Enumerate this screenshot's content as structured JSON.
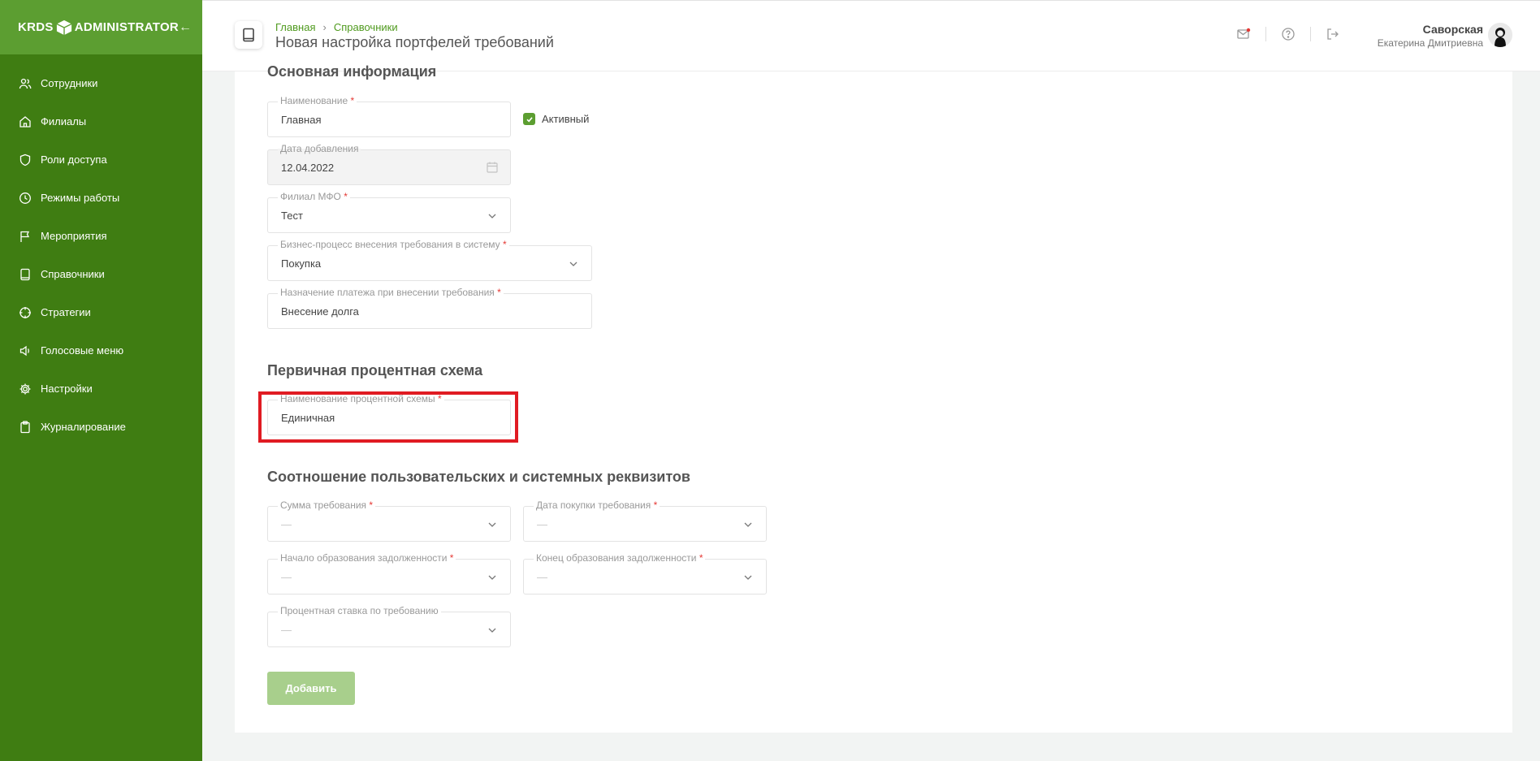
{
  "brand": {
    "logo_left": "KRDS",
    "logo_right": "ADMINISTRATOR"
  },
  "sidebar": {
    "items": [
      {
        "label": "Сотрудники",
        "icon": "users-icon"
      },
      {
        "label": "Филиалы",
        "icon": "home-icon"
      },
      {
        "label": "Роли доступа",
        "icon": "shield-icon"
      },
      {
        "label": "Режимы работы",
        "icon": "clock-icon"
      },
      {
        "label": "Мероприятия",
        "icon": "flag-icon"
      },
      {
        "label": "Справочники",
        "icon": "book-icon"
      },
      {
        "label": "Стратегии",
        "icon": "crosshair-icon"
      },
      {
        "label": "Голосовые меню",
        "icon": "speaker-icon"
      },
      {
        "label": "Настройки",
        "icon": "gear-icon"
      },
      {
        "label": "Журналирование",
        "icon": "clipboard-icon"
      }
    ]
  },
  "header": {
    "breadcrumb": [
      "Главная",
      "Справочники"
    ],
    "title": "Новая настройка портфелей требований",
    "user": {
      "last_name": "Саворская",
      "first_name": "Екатерина Дмитриевна"
    }
  },
  "form": {
    "section_main": "Основная информация",
    "name": {
      "label": "Наименование",
      "value": "Главная"
    },
    "active": {
      "label": "Активный",
      "checked": true
    },
    "date_added": {
      "label": "Дата добавления",
      "value": "12.04.2022"
    },
    "branch": {
      "label": "Филиал МФО",
      "value": "Тест"
    },
    "business_process": {
      "label": "Бизнес-процесс внесения требования в систему",
      "value": "Покупка"
    },
    "payment_purpose": {
      "label": "Назначение платежа при внесении требования",
      "value": "Внесение долга"
    },
    "section_interest": "Первичная процентная схема",
    "scheme_name": {
      "label": "Наименование процентной схемы",
      "value": "Единичная"
    },
    "section_mapping": "Соотношение пользовательских и системных реквизитов",
    "claim_amount": {
      "label": "Сумма требования",
      "value": "—"
    },
    "purchase_date": {
      "label": "Дата покупки требования",
      "value": "—"
    },
    "debt_start": {
      "label": "Начало образования задолженности",
      "value": "—"
    },
    "debt_end": {
      "label": "Конец образования задолженности",
      "value": "—"
    },
    "interest_rate": {
      "label": "Процентная ставка по требованию",
      "value": "—"
    },
    "required_mark": "*",
    "submit_label": "Добавить"
  },
  "colors": {
    "sidebar": "#3f7d12",
    "sidebar_top": "#5c9e31",
    "accent": "#4f9a1e",
    "required": "#e53935",
    "highlight": "#e01b22"
  }
}
